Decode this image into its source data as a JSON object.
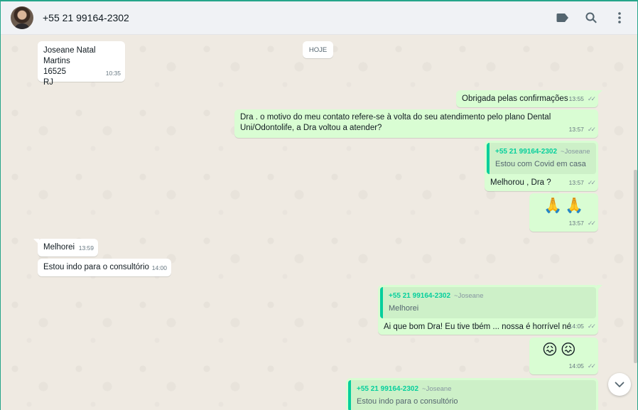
{
  "header": {
    "contact_name": "+55 21 99164-2302",
    "icons": [
      "label-icon",
      "search-icon",
      "menu-icon"
    ]
  },
  "chat": {
    "date_divider": "HOJE",
    "messages": [
      {
        "dir": "in",
        "lines": [
          "Joseane Natal Martins",
          "16525",
          "RJ"
        ],
        "time": "10:35"
      },
      {
        "dir": "out",
        "text": "Obrigada pelas confirmações",
        "time": "13:55"
      },
      {
        "dir": "out",
        "lines": [
          "Dra . o motivo do meu contato refere-se à volta do seu atendimento pelo plano Dental",
          "Uni/Odontolife, a Dra voltou a atender?"
        ],
        "time": "13:57"
      },
      {
        "dir": "out",
        "quote_author": "+55 21 99164-2302",
        "quote_alias": "~Joseane",
        "quote_text": "Estou com Covid em casa",
        "text": "Melhorou , Dra ?",
        "time": "13:57"
      },
      {
        "dir": "out",
        "emoji": "🙏🙏",
        "time": "13:57"
      },
      {
        "dir": "in",
        "text": "Melhorei",
        "time": "13:59"
      },
      {
        "dir": "in",
        "text": "Estou indo para o consultório",
        "time": "14:00"
      },
      {
        "dir": "out",
        "quote_author": "+55 21 99164-2302",
        "quote_alias": "~Joseane",
        "quote_text": "Melhorei",
        "text": "Ai que bom Dra! Eu tive tbém ... nossa é horrível né",
        "time": "14:05"
      },
      {
        "dir": "out",
        "emoji": "😖😖",
        "time": "14:05"
      },
      {
        "dir": "out",
        "quote_author": "+55 21 99164-2302",
        "quote_alias": "~Joseane",
        "quote_text": "Estou indo para o consultório"
      }
    ],
    "read_receipt": "✓✓"
  },
  "colors": {
    "accent": "#06cf9c",
    "outgoing_bubble": "#d9fdd3",
    "incoming_bubble": "#ffffff",
    "chat_background": "#efeae2",
    "header_background": "#f0f2f5"
  }
}
